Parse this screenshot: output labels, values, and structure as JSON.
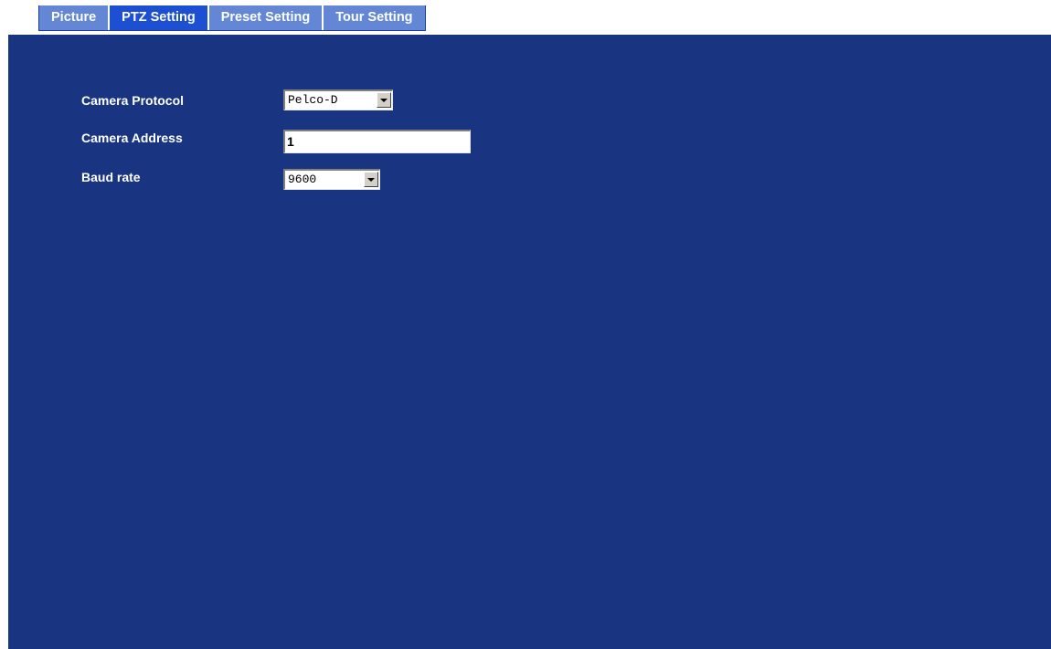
{
  "tabs": [
    {
      "label": "Picture",
      "active": false
    },
    {
      "label": "PTZ Setting",
      "active": true
    },
    {
      "label": "Preset Setting",
      "active": false
    },
    {
      "label": "Tour Setting",
      "active": false
    }
  ],
  "form": {
    "camera_protocol": {
      "label": "Camera Protocol",
      "value": "Pelco-D"
    },
    "camera_address": {
      "label": "Camera Address",
      "value": "1"
    },
    "baud_rate": {
      "label": "Baud rate",
      "value": "9600"
    }
  },
  "colors": {
    "panel_bg": "#193480",
    "tab_bg": "#6386d5",
    "tab_active_bg": "#1d4fd3"
  }
}
